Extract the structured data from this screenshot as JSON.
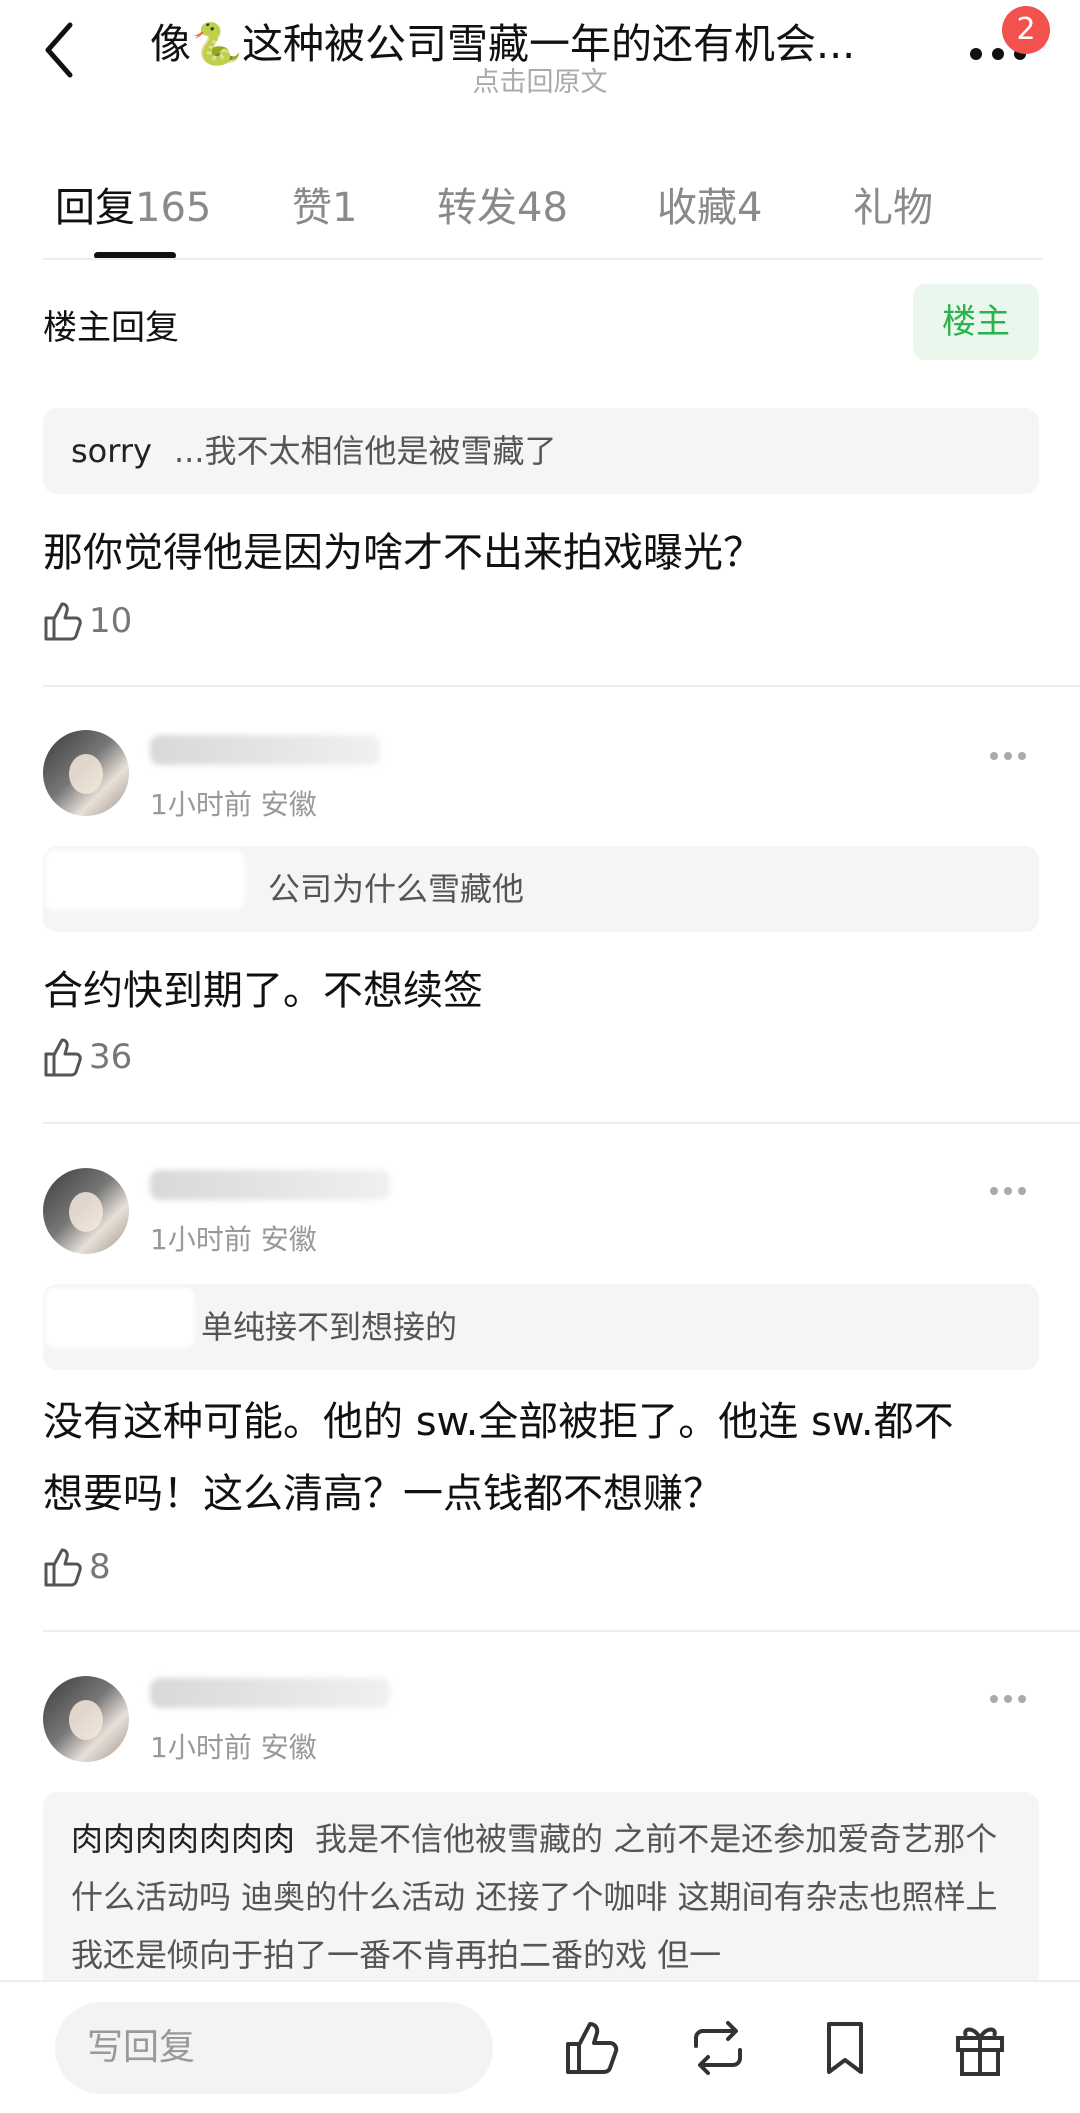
{
  "header": {
    "title": "像🐍这种被公司雪藏一年的还有机会...",
    "subtitle": "点击回原文",
    "badge": "2"
  },
  "tabs": [
    {
      "label": "回复",
      "count": "165"
    },
    {
      "label": "赞",
      "count": "1"
    },
    {
      "label": "转发",
      "count": "48"
    },
    {
      "label": "收藏",
      "count": "4"
    },
    {
      "label": "礼物",
      "count": ""
    }
  ],
  "section": {
    "title": "楼主回复",
    "op_button": "楼主"
  },
  "comments": [
    {
      "quote_name": "sorry",
      "quote_text": "...我不太相信他是被雪藏了",
      "text": "那你觉得他是因为啥才不出来拍戏曝光？",
      "likes": "10"
    },
    {
      "time": "1小时前",
      "location": "安徽",
      "quote_text": "公司为什么雪藏他",
      "text": "合约快到期了。不想续签",
      "likes": "36"
    },
    {
      "time": "1小时前",
      "location": "安徽",
      "quote_text": "单纯接不到想接的",
      "text_line1": "没有这种可能。他的 sw.全部被拒了。他连 sw.都不",
      "text_line2": "想要吗！这么清高？一点钱都不想赚？",
      "likes": "8"
    },
    {
      "time": "1小时前",
      "location": "安徽",
      "quote_name": "肉肉肉肉肉肉肉",
      "quote_text": "我是不信他被雪藏的 之前不是还参加爱奇艺那个什么活动吗 迪奥的什么活动 还接了个咖啡 这期间有杂志也照样上 我还是倾向于拍了一番不肯再拍二番的戏 但一"
    }
  ],
  "bottom": {
    "input_placeholder": "写回复"
  },
  "icons": [
    "back-arrow-icon",
    "more-dots-icon",
    "thumb-up-icon",
    "repost-icon",
    "bookmark-icon",
    "gift-icon"
  ],
  "colors": {
    "accent_green": "#2cb24c",
    "badge_red": "#f2514d"
  }
}
